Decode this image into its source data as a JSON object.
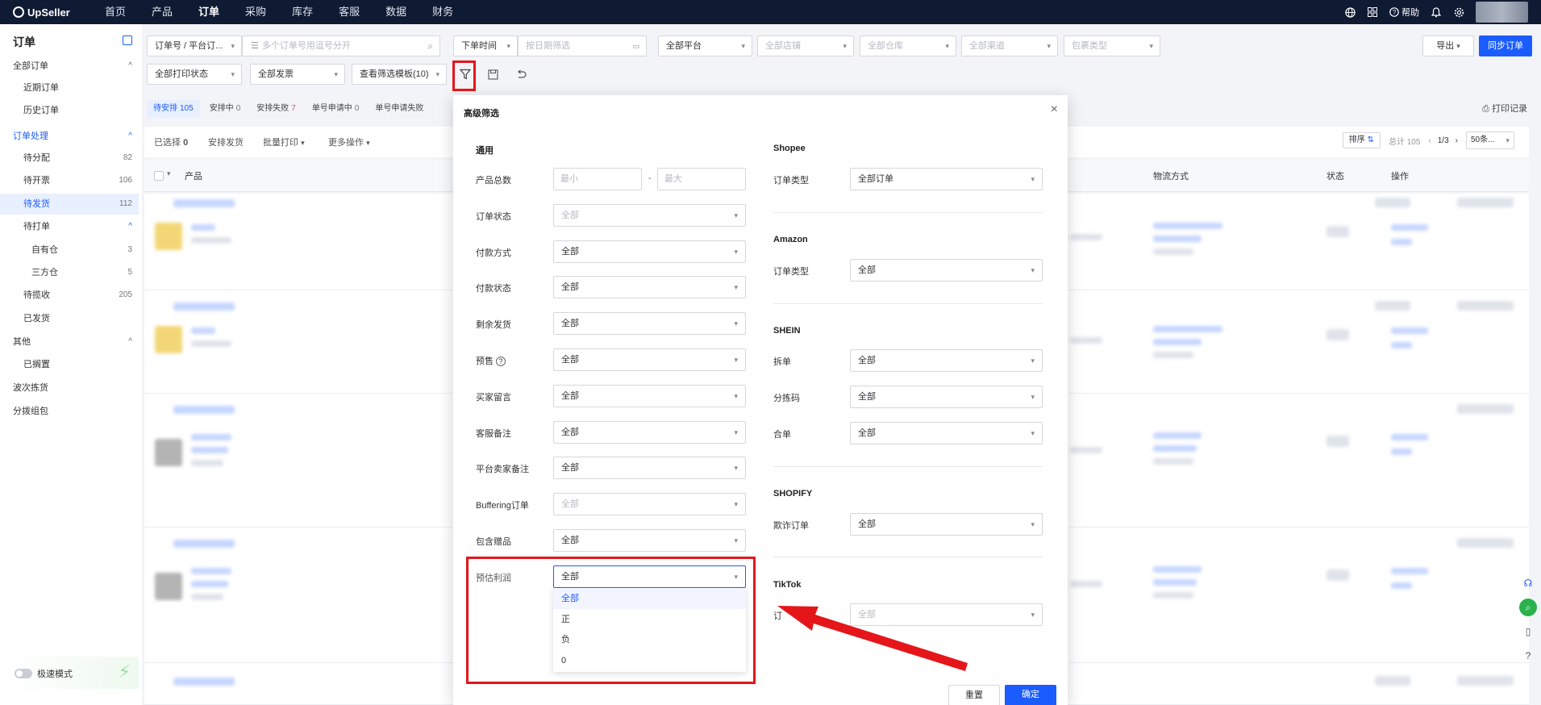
{
  "topnav": {
    "brand": "UpSeller",
    "items": [
      "首页",
      "产品",
      "订单",
      "采购",
      "库存",
      "客服",
      "数据",
      "财务"
    ],
    "active_index": 2,
    "help_label": "帮助"
  },
  "sidebar": {
    "title": "订单",
    "items": [
      {
        "label": "全部订单",
        "count": "",
        "caret": "^"
      },
      {
        "label": "近期订单",
        "count": "",
        "caret": ""
      },
      {
        "label": "历史订单",
        "count": "",
        "caret": ""
      },
      {
        "label": "订单处理",
        "count": "",
        "caret": "^"
      },
      {
        "label": "待分配",
        "count": "82",
        "caret": ""
      },
      {
        "label": "待开票",
        "count": "106",
        "caret": ""
      },
      {
        "label": "待发货",
        "count": "112",
        "caret": ""
      },
      {
        "label": "待打单",
        "count": "",
        "caret": "^"
      },
      {
        "label": "自有仓",
        "count": "3",
        "caret": ""
      },
      {
        "label": "三方仓",
        "count": "5",
        "caret": ""
      },
      {
        "label": "待揽收",
        "count": "205",
        "caret": ""
      },
      {
        "label": "已发货",
        "count": "",
        "caret": ""
      },
      {
        "label": "其他",
        "count": "",
        "caret": "^"
      },
      {
        "label": "已搁置",
        "count": "",
        "caret": ""
      },
      {
        "label": "波次拣货",
        "count": "",
        "caret": ""
      },
      {
        "label": "分拨组包",
        "count": "",
        "caret": ""
      }
    ],
    "fast_mode": "极速模式"
  },
  "filters": {
    "order_no_type": "订单号 / 平台订...",
    "search_placeholder": "多个订单号用逗号分开",
    "time_type": "下单时间",
    "date_placeholder": "按日期筛选",
    "platform": "全部平台",
    "store": "全部店铺",
    "warehouse": "全部仓库",
    "channel": "全部渠道",
    "package_type": "包裹类型",
    "print_status": "全部打印状态",
    "invoice": "全部发票",
    "template": "查看筛选模板(10)",
    "export": "导出",
    "sync": "同步订单"
  },
  "tabs": [
    {
      "label": "待安排",
      "count": "105"
    },
    {
      "label": "安排中",
      "count": "0"
    },
    {
      "label": "安排失败",
      "count": "7"
    },
    {
      "label": "单号申请中",
      "count": "0"
    },
    {
      "label": "单号申请失败",
      "count": ""
    }
  ],
  "print_record": "打印记录",
  "toolbar": {
    "selected_label": "已选择",
    "selected_count": "0",
    "arrange": "安排发货",
    "batch_print": "批量打印",
    "more": "更多操作",
    "sort": "排序",
    "total": "总计 105",
    "page": "1/3",
    "page_size": "50条..."
  },
  "table": {
    "col_product": "产品",
    "col_shipping": "物流方式",
    "col_status": "状态",
    "col_action": "操作"
  },
  "modal": {
    "title": "高级筛选",
    "left_section": "通用",
    "min_placeholder": "最小",
    "max_placeholder": "最大",
    "range_dash": "-",
    "fields": [
      {
        "label": "产品总数",
        "value": ""
      },
      {
        "label": "订单状态",
        "value": "全部"
      },
      {
        "label": "付款方式",
        "value": "全部"
      },
      {
        "label": "付款状态",
        "value": "全部"
      },
      {
        "label": "剩余发货",
        "value": "全部"
      },
      {
        "label": "预售",
        "value": "全部"
      },
      {
        "label": "买家留言",
        "value": "全部"
      },
      {
        "label": "客服备注",
        "value": "全部"
      },
      {
        "label": "平台卖家备注",
        "value": "全部"
      },
      {
        "label": "Buffering订单",
        "value": "全部"
      },
      {
        "label": "包含赠品",
        "value": "全部"
      },
      {
        "label": "预估利润",
        "value": "全部"
      }
    ],
    "dropdown_options": [
      "全部",
      "正",
      "负",
      "0"
    ],
    "shopee": {
      "title": "Shopee",
      "label": "订单类型",
      "value": "全部订单"
    },
    "amazon": {
      "title": "Amazon",
      "label": "订单类型",
      "value": "全部"
    },
    "shein": {
      "title": "SHEIN",
      "fields": [
        {
          "label": "拆单",
          "value": "全部"
        },
        {
          "label": "分拣码",
          "value": "全部"
        },
        {
          "label": "合单",
          "value": "全部"
        }
      ]
    },
    "shopify": {
      "title": "SHOPIFY",
      "label": "欺诈订单",
      "value": "全部"
    },
    "tiktok": {
      "title": "TikTok",
      "label": "订",
      "value": "全部"
    },
    "reset": "重置",
    "confirm": "确定"
  },
  "colors": {
    "accent": "#1a5cff",
    "nav_bg": "#0f1a33",
    "highlight": "#e5161a"
  }
}
